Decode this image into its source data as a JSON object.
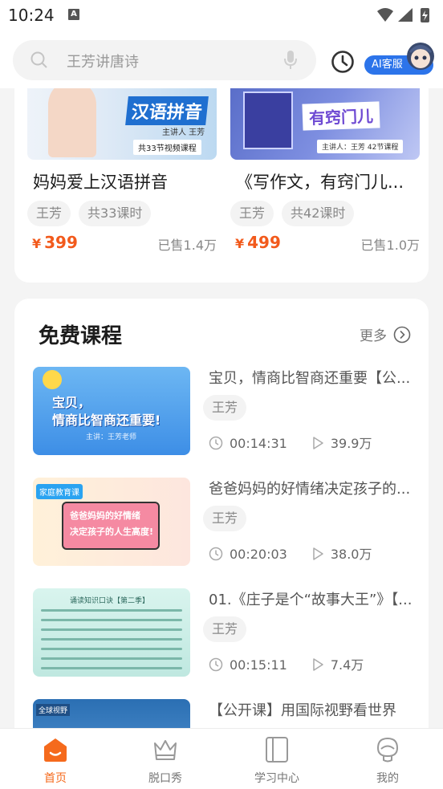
{
  "status_bar": {
    "time": "10:24",
    "notification_icon": "A"
  },
  "search": {
    "placeholder": "王芳讲唐诗"
  },
  "ai_service": {
    "label": "AI客服"
  },
  "paid_courses": [
    {
      "title": "妈妈爱上汉语拼音",
      "thumb_title": "汉语拼音",
      "thumb_presenter": "主讲人 王芳",
      "thumb_episodes": "共33节视频课程",
      "teacher": "王芳",
      "lessons": "共33课时",
      "currency": "¥",
      "price": "399",
      "sold": "已售1.4万"
    },
    {
      "title": "《写作文，有窍门儿...",
      "thumb_title": "有窍门儿",
      "thumb_presenter": "主讲人：王芳 42节课程",
      "teacher": "王芳",
      "lessons": "共42课时",
      "currency": "¥",
      "price": "499",
      "sold": "已售1.0万"
    }
  ],
  "free_section": {
    "title": "免费课程",
    "more_label": "更多",
    "items": [
      {
        "title": "宝贝，情商比智商还重要【公...",
        "thumb_text": "宝贝，\n情商比智商还重要!",
        "thumb_sub": "主讲：王芳老师",
        "teacher": "王芳",
        "duration": "00:14:31",
        "plays": "39.9万"
      },
      {
        "title": "爸爸妈妈的好情绪决定孩子的...",
        "thumb_text": "爸爸妈妈的好情绪\n决定孩子的人生高度!",
        "thumb_tag": "家庭教育课",
        "teacher": "王芳",
        "duration": "00:20:03",
        "plays": "38.0万"
      },
      {
        "title": "01.《庄子是个“故事大王”》【...",
        "thumb_text": "诵读知识口诀【第二季】",
        "teacher": "王芳",
        "duration": "00:15:11",
        "plays": "7.4万"
      },
      {
        "title": "【公开课】用国际视野看世界",
        "thumb_text": "全球视野"
      }
    ]
  },
  "bottom_nav": [
    {
      "label": "首页",
      "icon": "home-icon",
      "active": true
    },
    {
      "label": "脱口秀",
      "icon": "crown-icon",
      "active": false
    },
    {
      "label": "学习中心",
      "icon": "book-icon",
      "active": false
    },
    {
      "label": "我的",
      "icon": "profile-icon",
      "active": false
    }
  ],
  "colors": {
    "accent": "#f56a1c",
    "price": "#f25a1c",
    "ai_badge": "#2c74ea"
  }
}
